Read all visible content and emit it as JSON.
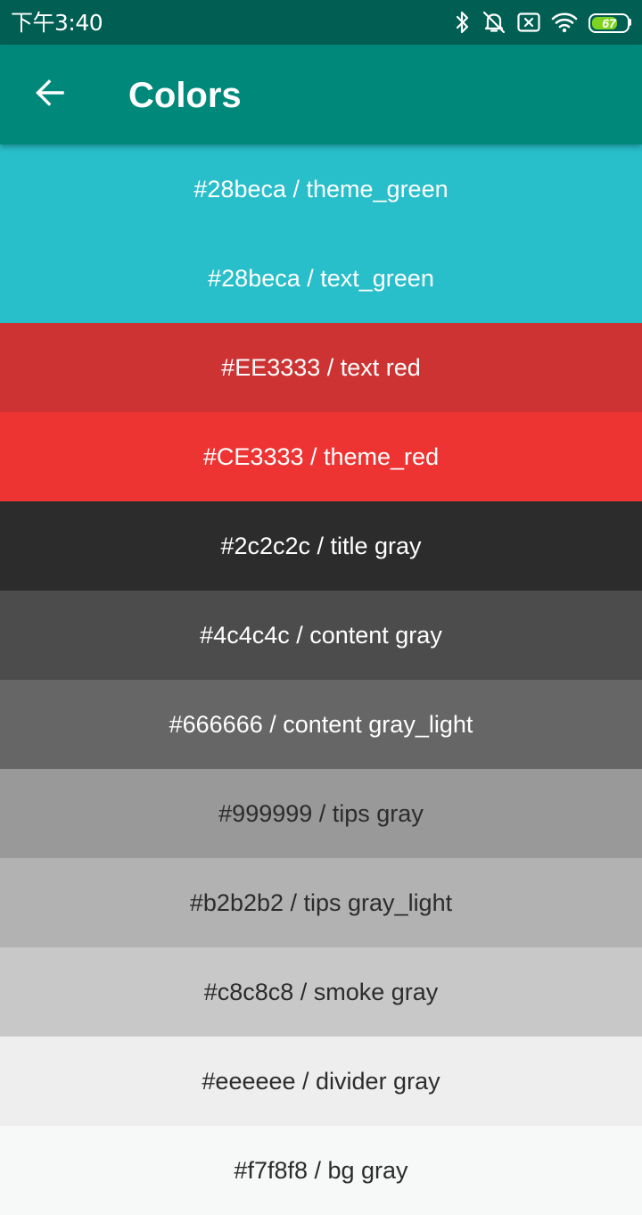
{
  "status_bar": {
    "time": "下午3:40",
    "battery_level": "67",
    "background": "#005f52",
    "icons": [
      "bluetooth-icon",
      "alarm-off-icon",
      "sim-x-icon",
      "wifi-icon",
      "battery-icon"
    ]
  },
  "app_bar": {
    "title": "Colors",
    "background": "#00897b",
    "back_icon": "arrow-back-icon"
  },
  "colors": [
    {
      "label": "#28beca / theme_green",
      "bg": "#28beca",
      "fg": "#ffffff"
    },
    {
      "label": "#28beca / text_green",
      "bg": "#28beca",
      "fg": "#ffffff"
    },
    {
      "label": "#EE3333 / text red",
      "bg": "#cd3333",
      "fg": "#ffffff"
    },
    {
      "label": "#CE3333 / theme_red",
      "bg": "#ee3333",
      "fg": "#ffffff"
    },
    {
      "label": "#2c2c2c / title gray",
      "bg": "#2c2c2c",
      "fg": "#ffffff"
    },
    {
      "label": "#4c4c4c / content gray",
      "bg": "#4c4c4c",
      "fg": "#ffffff"
    },
    {
      "label": "#666666 / content gray_light",
      "bg": "#666666",
      "fg": "#ffffff"
    },
    {
      "label": "#999999 / tips gray",
      "bg": "#999999",
      "fg": "#2c2c2c"
    },
    {
      "label": "#b2b2b2 / tips gray_light",
      "bg": "#b2b2b2",
      "fg": "#2c2c2c"
    },
    {
      "label": "#c8c8c8 / smoke gray",
      "bg": "#c8c8c8",
      "fg": "#2c2c2c"
    },
    {
      "label": "#eeeeee / divider gray",
      "bg": "#eeeeee",
      "fg": "#2c2c2c"
    },
    {
      "label": "#f7f8f8 / bg gray",
      "bg": "#f7f8f8",
      "fg": "#2c2c2c"
    }
  ]
}
